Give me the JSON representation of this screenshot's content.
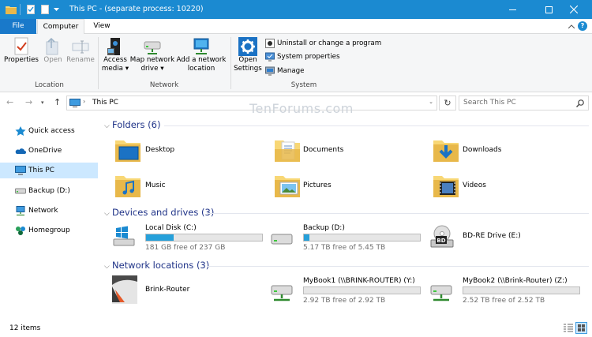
{
  "window": {
    "title": "This PC - (separate process: 10220)"
  },
  "tabs": {
    "file": "File",
    "computer": "Computer",
    "view": "View"
  },
  "ribbon": {
    "location": {
      "group": "Location",
      "properties": "Properties",
      "open": "Open",
      "rename": "Rename"
    },
    "network": {
      "group": "Network",
      "access_media_1": "Access",
      "access_media_2": "media",
      "map_drive_1": "Map network",
      "map_drive_2": "drive",
      "add_location_1": "Add a network",
      "add_location_2": "location"
    },
    "system": {
      "group": "System",
      "open_settings_1": "Open",
      "open_settings_2": "Settings",
      "uninstall": "Uninstall or change a program",
      "sys_props": "System properties",
      "manage": "Manage"
    }
  },
  "address": {
    "path": "This PC",
    "search_placeholder": "Search This PC"
  },
  "watermark": "TenForums.com",
  "sidebar": {
    "items": [
      {
        "label": "Quick access"
      },
      {
        "label": "OneDrive"
      },
      {
        "label": "This PC"
      },
      {
        "label": "Backup (D:)"
      },
      {
        "label": "Network"
      },
      {
        "label": "Homegroup"
      }
    ]
  },
  "folders": {
    "header": "Folders (6)",
    "items": [
      {
        "name": "Desktop"
      },
      {
        "name": "Documents"
      },
      {
        "name": "Downloads"
      },
      {
        "name": "Music"
      },
      {
        "name": "Pictures"
      },
      {
        "name": "Videos"
      }
    ]
  },
  "drives": {
    "header": "Devices and drives (3)",
    "items": [
      {
        "name": "Local Disk (C:)",
        "free": "181 GB free of 237 GB",
        "used_fraction": 0.24
      },
      {
        "name": "Backup (D:)",
        "free": "5.17 TB free of 5.45 TB",
        "used_fraction": 0.05
      },
      {
        "name": "BD-RE Drive (E:)"
      }
    ]
  },
  "netloc": {
    "header": "Network locations (3)",
    "items": [
      {
        "name": "Brink-Router"
      },
      {
        "name": "MyBook1 (\\\\BRINK-ROUTER) (Y:)",
        "free": "2.92 TB free of 2.92 TB",
        "used_fraction": 0.0
      },
      {
        "name": "MyBook2 (\\\\Brink-Router) (Z:)",
        "free": "2.52 TB free of 2.52 TB",
        "used_fraction": 0.0
      }
    ]
  },
  "status": {
    "count": "12 items"
  },
  "colors": {
    "title_bar": "#1b8ad1",
    "selection": "#cce8ff",
    "progress": "#26a0da",
    "header_text": "#1e3287"
  }
}
